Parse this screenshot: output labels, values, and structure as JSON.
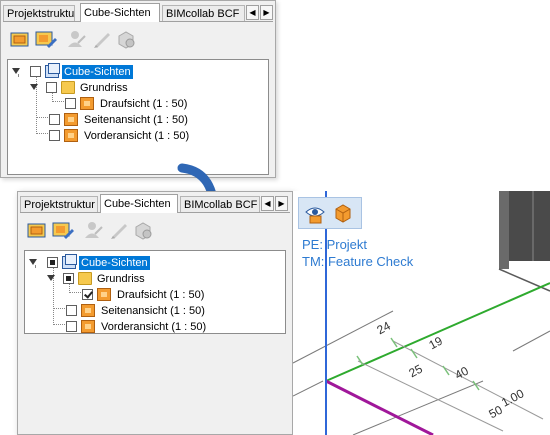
{
  "panel_top": {
    "tabs": [
      "Projektstruktur",
      "Cube-Sichten",
      "BIMcollab BCF"
    ],
    "tree": {
      "root": "Cube-Sichten",
      "folder": "Grundriss",
      "items": [
        "Draufsicht (1 : 50)",
        "Seitenansicht (1 : 50)",
        "Vorderansicht (1 : 50)"
      ]
    }
  },
  "panel_bottom": {
    "tabs": [
      "Projektstruktur",
      "Cube-Sichten",
      "BIMcollab BCF"
    ],
    "tree": {
      "root": "Cube-Sichten",
      "folder": "Grundriss",
      "items": [
        "Draufsicht (1 : 50)",
        "Seitenansicht (1 : 50)",
        "Vorderansicht (1 : 50)"
      ]
    }
  },
  "arrows": {
    "left": "◀",
    "right": "▶"
  },
  "viewport": {
    "line1": "PE: Projekt",
    "line2": "TM: Feature Check",
    "dimensions": [
      "24",
      "19",
      "25",
      "40",
      "1.00",
      "50"
    ]
  },
  "icons": {
    "toolbar": [
      "new-view-icon",
      "edit-view-icon",
      "user-icon",
      "pencil-icon",
      "cube-settings-icon"
    ],
    "viewport": [
      "eye-icon",
      "cube-icon"
    ],
    "accent": "#0078d7",
    "arrow_color": "#2f67b5"
  }
}
